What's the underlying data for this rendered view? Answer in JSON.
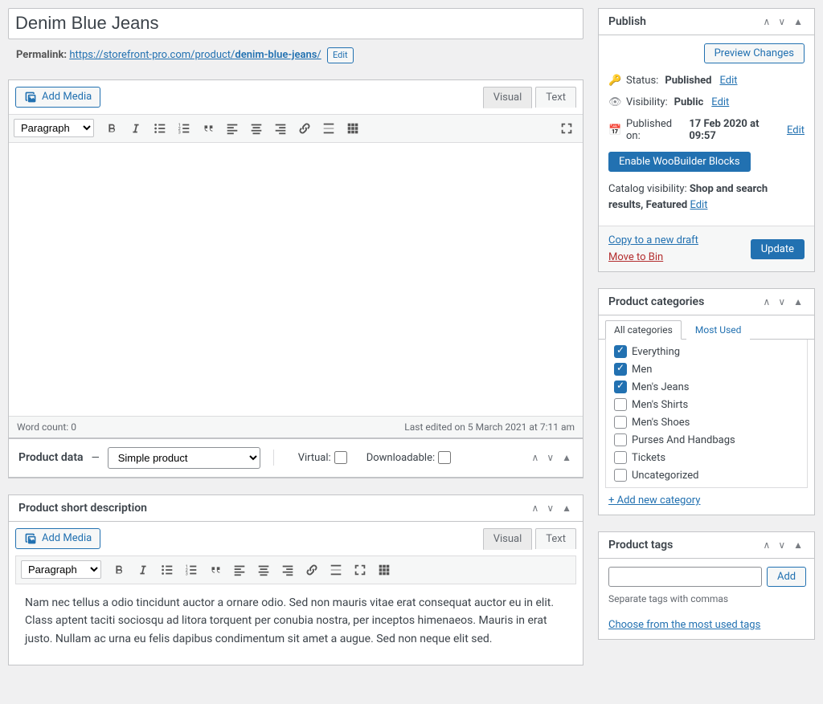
{
  "title": "Denim Blue Jeans",
  "permalink": {
    "label": "Permalink:",
    "base": "https://storefront-pro.com/product/",
    "slug": "denim-blue-jeans",
    "trail": "/",
    "edit": "Edit"
  },
  "editor": {
    "add_media": "Add Media",
    "tabs": {
      "visual": "Visual",
      "text": "Text"
    },
    "format": "Paragraph",
    "word_count_label": "Word count:",
    "word_count": "0",
    "last_edited": "Last edited on 5 March 2021 at 7:11 am"
  },
  "product_data": {
    "title": "Product data",
    "dash": "—",
    "type": "Simple product",
    "virtual_label": "Virtual:",
    "downloadable_label": "Downloadable:"
  },
  "short_desc": {
    "title": "Product short description",
    "add_media": "Add Media",
    "format": "Paragraph",
    "tabs": {
      "visual": "Visual",
      "text": "Text"
    },
    "body": "Nam nec tellus a odio tincidunt auctor a ornare odio. Sed non mauris vitae erat consequat auctor eu in elit. Class aptent taciti sociosqu ad litora torquent per conubia nostra, per inceptos himenaeos. Mauris in erat justo. Nullam ac urna eu felis dapibus condimentum sit amet a augue. Sed non neque elit sed."
  },
  "publish": {
    "title": "Publish",
    "preview": "Preview Changes",
    "status_label": "Status:",
    "status_value": "Published",
    "visibility_label": "Visibility:",
    "visibility_value": "Public",
    "published_label": "Published on:",
    "published_value": "17 Feb 2020 at 09:57",
    "edit": "Edit",
    "enable_blocks": "Enable WooBuilder Blocks",
    "catalog_label": "Catalog visibility:",
    "catalog_value": "Shop and search results, Featured",
    "copy_draft": "Copy to a new draft",
    "move_bin": "Move to Bin",
    "update": "Update"
  },
  "categories": {
    "title": "Product categories",
    "tab_all": "All categories",
    "tab_most": "Most Used",
    "items": [
      {
        "label": "Everything",
        "checked": true
      },
      {
        "label": "Men",
        "checked": true
      },
      {
        "label": "Men's Jeans",
        "checked": true
      },
      {
        "label": "Men's Shirts",
        "checked": false
      },
      {
        "label": "Men's Shoes",
        "checked": false
      },
      {
        "label": "Purses And Handbags",
        "checked": false
      },
      {
        "label": "Tickets",
        "checked": false
      },
      {
        "label": "Uncategorized",
        "checked": false
      }
    ],
    "add_new": "+ Add new category"
  },
  "tags": {
    "title": "Product tags",
    "add": "Add",
    "hint": "Separate tags with commas",
    "choose": "Choose from the most used tags"
  }
}
